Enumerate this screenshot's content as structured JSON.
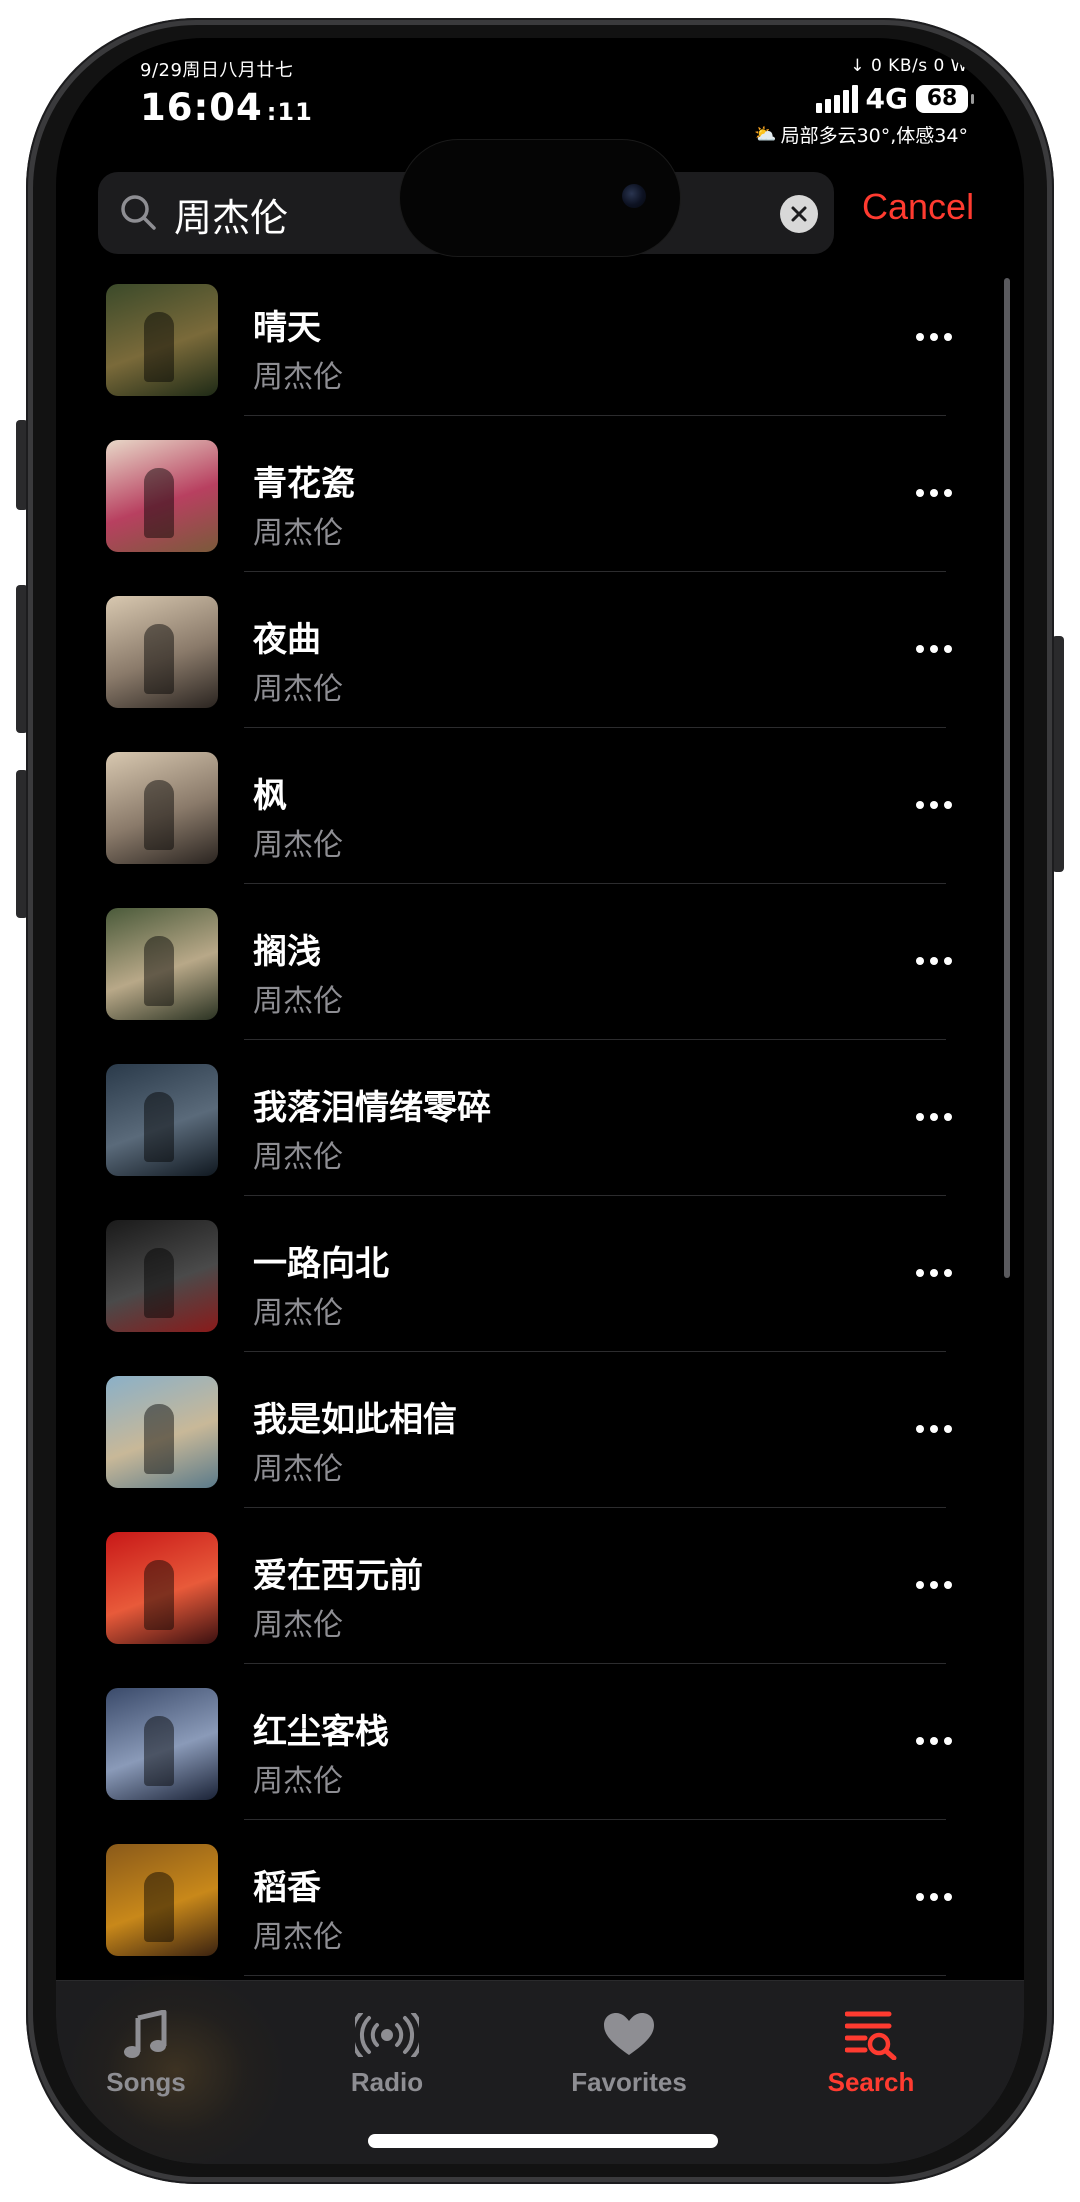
{
  "status_bar": {
    "date": "9/29周日八月廿七",
    "time": "16:04",
    "seconds": ":11",
    "net_speed": "↓ 0 KB/s  0 W",
    "network_type": "4G",
    "battery": "68",
    "weather": "局部多云30°,体感34°"
  },
  "search": {
    "value": "周杰伦",
    "cancel_label": "Cancel"
  },
  "songs": [
    {
      "title": "晴天",
      "artist": "周杰伦",
      "art_colors": [
        "#3b4a2a",
        "#7a6a3a",
        "#1e2a16"
      ]
    },
    {
      "title": "青花瓷",
      "artist": "周杰伦",
      "art_colors": [
        "#e8d8c8",
        "#b84060",
        "#7a5a3a"
      ]
    },
    {
      "title": "夜曲",
      "artist": "周杰伦",
      "art_colors": [
        "#d8c8b0",
        "#8a7a6a",
        "#2a2420"
      ]
    },
    {
      "title": "枫",
      "artist": "周杰伦",
      "art_colors": [
        "#d8c8b0",
        "#8a7a6a",
        "#2a2420"
      ]
    },
    {
      "title": "搁浅",
      "artist": "周杰伦",
      "art_colors": [
        "#4a5a3a",
        "#b8a888",
        "#2a3222"
      ]
    },
    {
      "title": "我落泪情绪零碎",
      "artist": "周杰伦",
      "art_colors": [
        "#2a3a4a",
        "#5a6a7a",
        "#101820"
      ]
    },
    {
      "title": "一路向北",
      "artist": "周杰伦",
      "art_colors": [
        "#1a1a1a",
        "#4a4a4a",
        "#8a1a1a"
      ]
    },
    {
      "title": "我是如此相信",
      "artist": "周杰伦",
      "art_colors": [
        "#8ab0c8",
        "#c8b898",
        "#5a7a8a"
      ]
    },
    {
      "title": "爱在西元前",
      "artist": "周杰伦",
      "art_colors": [
        "#c81818",
        "#e85a3a",
        "#3a1010"
      ]
    },
    {
      "title": "红尘客栈",
      "artist": "周杰伦",
      "art_colors": [
        "#3a4a6a",
        "#8a9ab8",
        "#1a2236"
      ]
    },
    {
      "title": "稻香",
      "artist": "周杰伦",
      "art_colors": [
        "#8a5a1a",
        "#c8881a",
        "#3a2210"
      ]
    }
  ],
  "tabs": [
    {
      "label": "Songs",
      "icon": "music-note-icon",
      "active": false
    },
    {
      "label": "Radio",
      "icon": "radio-icon",
      "active": false
    },
    {
      "label": "Favorites",
      "icon": "heart-icon",
      "active": false
    },
    {
      "label": "Search",
      "icon": "search-list-icon",
      "active": true
    }
  ],
  "colors": {
    "accent": "#ff3b30",
    "background": "#000000",
    "secondary_text": "#8e8e93",
    "inactive_tab": "#8e8e93"
  }
}
